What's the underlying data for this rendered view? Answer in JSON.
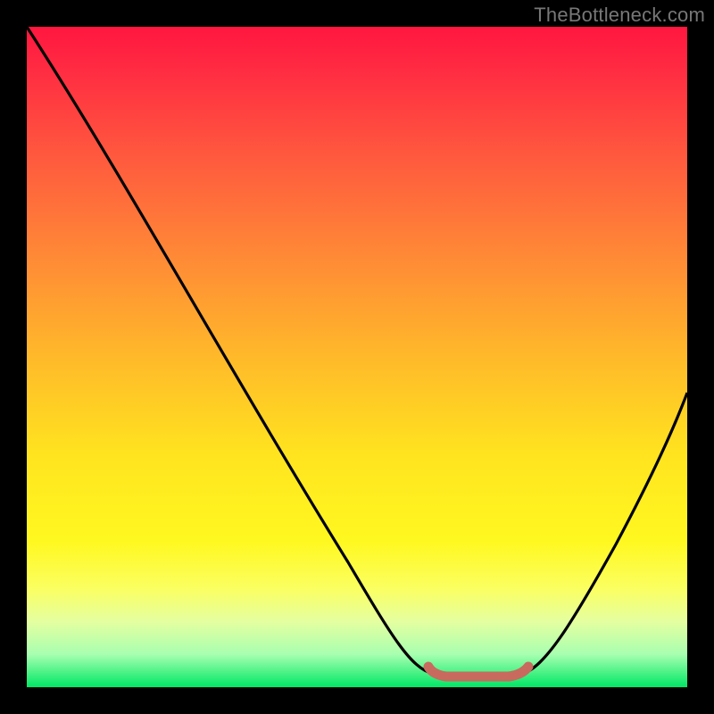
{
  "watermark": "TheBottleneck.com",
  "chart_data": {
    "type": "line",
    "title": "",
    "xlabel": "",
    "ylabel": "",
    "xlim": [
      0,
      100
    ],
    "ylim": [
      0,
      100
    ],
    "series": [
      {
        "name": "bottleneck-curve",
        "x": [
          0,
          10,
          20,
          30,
          40,
          50,
          58,
          63,
          68,
          73,
          80,
          90,
          100
        ],
        "values": [
          100,
          85,
          70,
          55,
          40,
          25,
          10,
          2,
          2,
          2,
          12,
          32,
          52
        ]
      }
    ],
    "highlight": {
      "name": "optimal-range",
      "x_start": 61,
      "x_end": 75,
      "color": "#c96a5f"
    },
    "background": {
      "type": "vertical-gradient",
      "stops": [
        {
          "pos": 0.0,
          "color": "#ff163f"
        },
        {
          "pos": 0.5,
          "color": "#ffd324"
        },
        {
          "pos": 0.85,
          "color": "#faff5e"
        },
        {
          "pos": 1.0,
          "color": "#00e765"
        }
      ]
    }
  }
}
